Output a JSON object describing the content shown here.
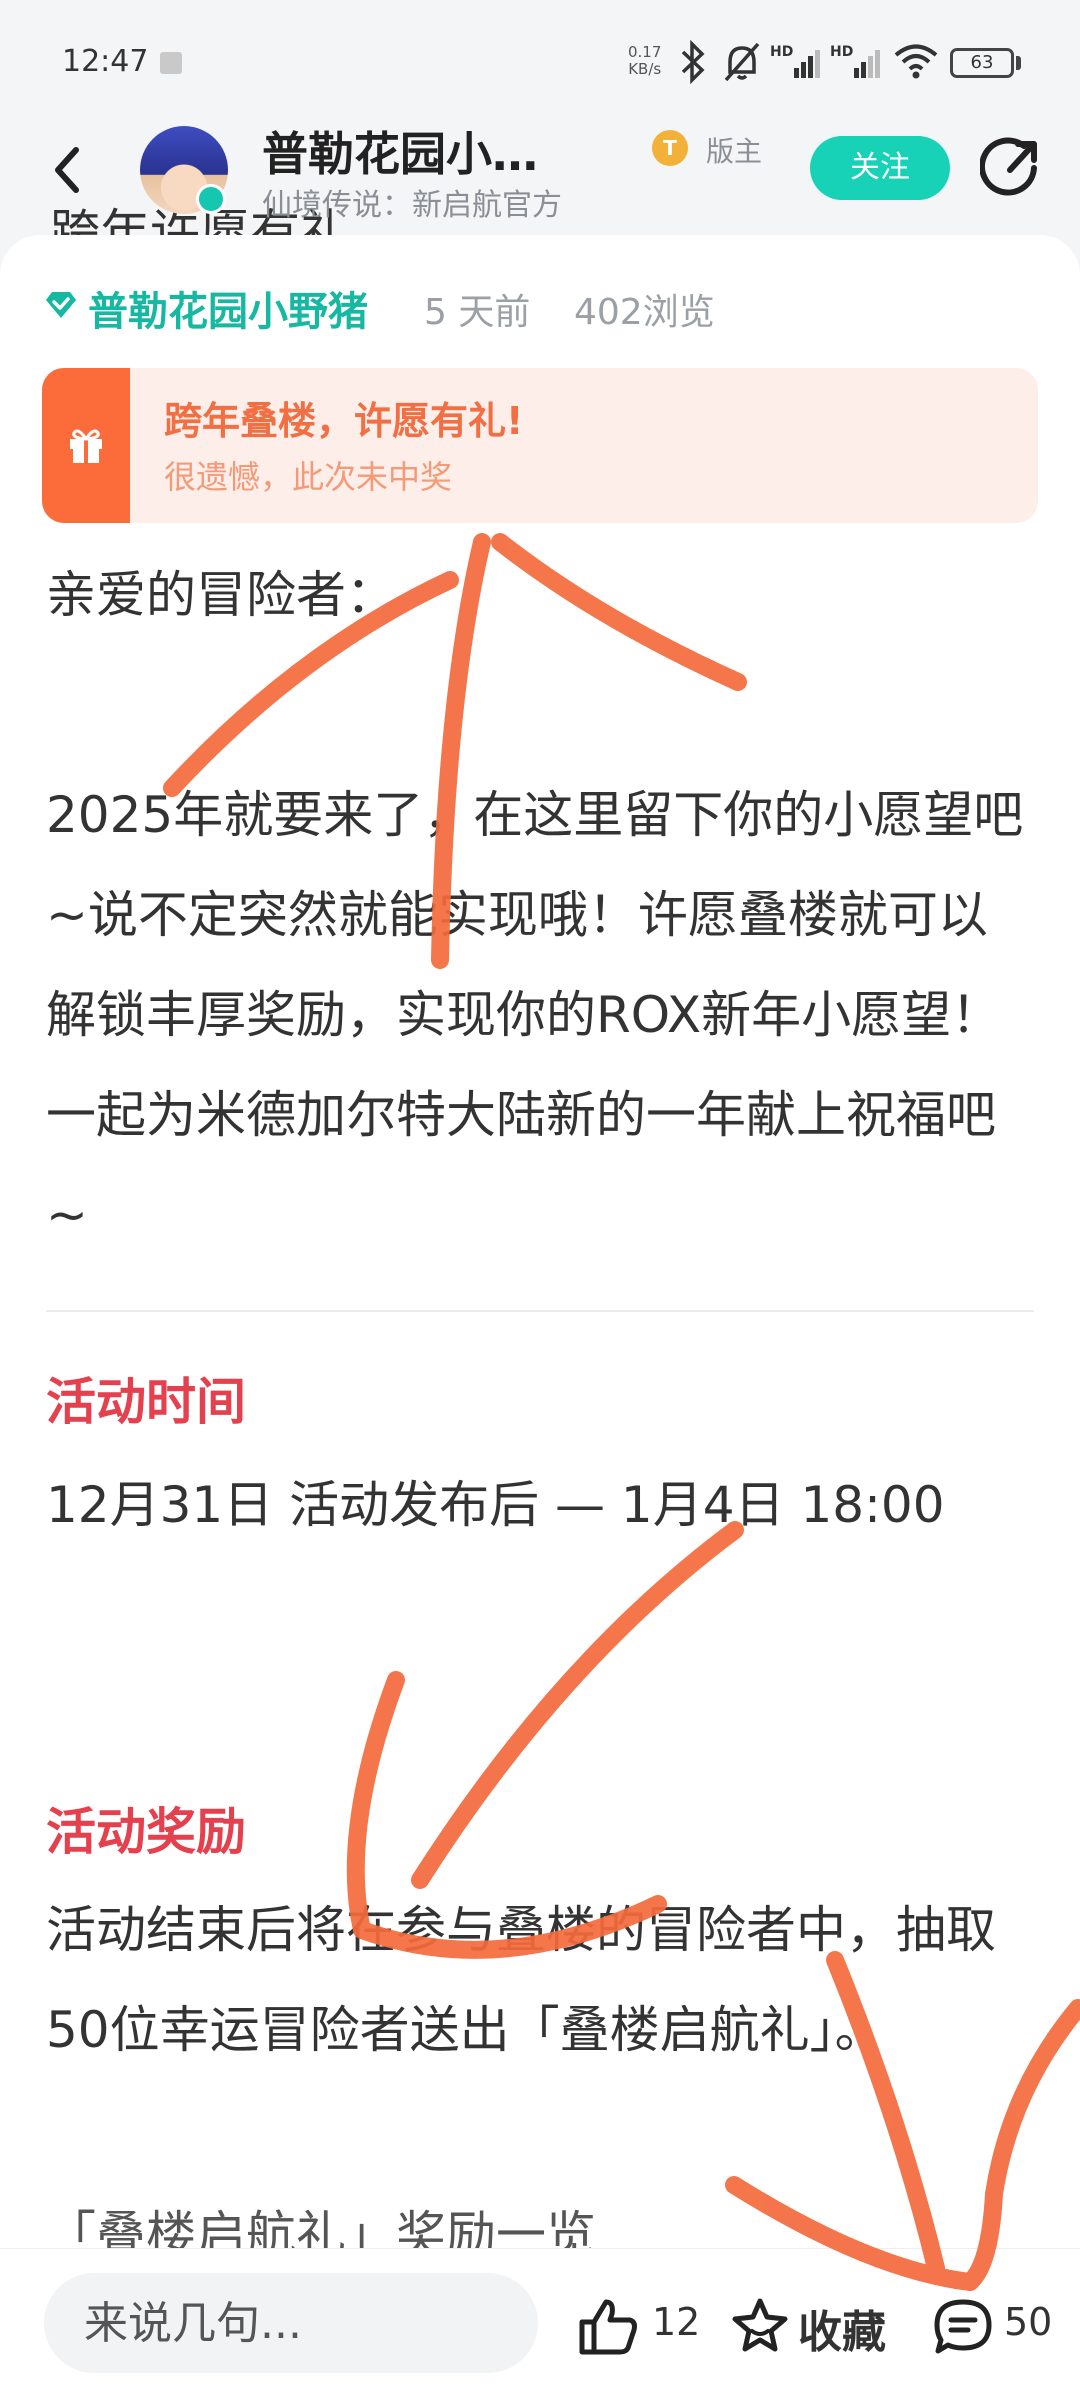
{
  "status_bar": {
    "time": "12:47",
    "net_speed_value": "0.17",
    "net_speed_unit": "KB/s",
    "signal_label_1": "HD",
    "signal_label_2": "HD",
    "battery": "63"
  },
  "header": {
    "title": "普勒花园小…",
    "subtitle": "仙境传说：新启航官方",
    "mod_badge": "T",
    "mod_label": "版主",
    "follow_label": "关注"
  },
  "post": {
    "title_partial": "跨年许愿有礼",
    "author": "普勒花园小野猪",
    "time": "5 天前",
    "views": "402浏览",
    "lottery": {
      "title": "跨年叠楼，许愿有礼!",
      "result": "很遗憾，此次未中奖"
    },
    "greeting": "亲爱的冒险者：",
    "intro": "2025年就要来了，在这里留下你的小愿望吧~说不定突然就能实现哦！许愿叠楼就可以解锁丰厚奖励，实现你的ROX新年小愿望！一起为米德加尔特大陆新的一年献上祝福吧~",
    "sections": [
      {
        "title": "活动时间",
        "text": "12月31日 活动发布后 — 1月4日 18:00"
      },
      {
        "title": "活动奖励",
        "text": "活动结束后将在参与叠楼的冒险者中，抽取50位幸运冒险者送出「叠楼启航礼」。"
      }
    ],
    "reward_list_partial": "「叠楼启航礼」奖励一览"
  },
  "bottom_bar": {
    "comment_placeholder": "来说几句...",
    "likes": "12",
    "favorite_label": "收藏",
    "comments": "50"
  },
  "colors": {
    "accent": "#17d2b7",
    "author": "#16b8a2",
    "section_title": "#e4404d",
    "banner_bg": "#fdeee9",
    "banner_strip": "#fb6c3a",
    "scribble": "#f46a3c"
  },
  "icons": [
    "back-icon",
    "share-icon",
    "verified-icon",
    "gift-icon",
    "like-icon",
    "star-icon",
    "comment-icon",
    "bluetooth-icon",
    "mute-icon",
    "wifi-icon"
  ]
}
